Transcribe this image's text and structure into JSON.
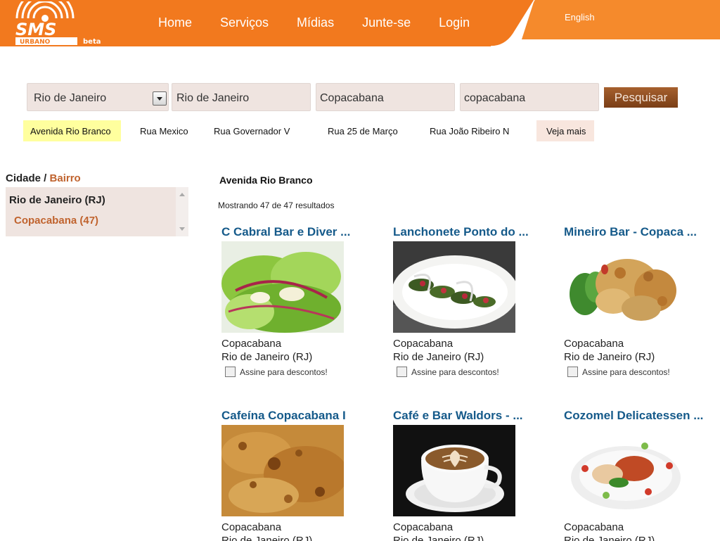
{
  "header": {
    "logo_text": "SMS",
    "logo_sub": "URBANO",
    "logo_beta": "beta",
    "nav": [
      "Home",
      "Serviços",
      "Mídias",
      "Junte-se",
      "Login"
    ],
    "language": "English",
    "colors": {
      "brand_orange": "#f2791e",
      "link_blue": "#155a8a",
      "accent_brown": "#c0632e"
    }
  },
  "search": {
    "state_select": "Rio de Janeiro",
    "city": "Rio de Janeiro",
    "neighborhood": "Copacabana",
    "query": "copacabana",
    "button": "Pesquisar"
  },
  "streets": {
    "items": [
      "Avenida Rio Branco",
      "Rua Mexico",
      "Rua Governador  V",
      "Rua 25 de Março",
      "Rua João Ribeiro  N"
    ],
    "active_index": 0,
    "more": "Veja mais"
  },
  "sidebar": {
    "title_city": "Cidade",
    "title_sep": " / ",
    "title_bairro": "Bairro",
    "city": "Rio de Janeiro (RJ)",
    "bairro": "Copacabana (47)"
  },
  "results": {
    "heading": "Avenida Rio Branco",
    "count_text": "Mostrando 47 de 47 resultados",
    "items": [
      {
        "title": "C Cabral Bar e Diver ...",
        "neighborhood": "Copacabana",
        "city": "Rio de Janeiro (RJ)",
        "subscribe": "Assine para descontos!",
        "image": "salad-photo"
      },
      {
        "title": "Lanchonete Ponto do ...",
        "neighborhood": "Copacabana",
        "city": "Rio de Janeiro (RJ)",
        "subscribe": "Assine para descontos!",
        "image": "appetizer-plate-photo"
      },
      {
        "title": "Mineiro Bar - Copaca ...",
        "neighborhood": "Copacabana",
        "city": "Rio de Janeiro (RJ)",
        "subscribe": "Assine para descontos!",
        "image": "fried-food-photo"
      },
      {
        "title": "Cafeína Copacabana I",
        "neighborhood": "Copacabana",
        "city": "Rio de Janeiro (RJ)",
        "subscribe": "",
        "image": "pastry-crumble-photo"
      },
      {
        "title": "Café e Bar Waldors - ...",
        "neighborhood": "Copacabana",
        "city": "Rio de Janeiro (RJ)",
        "subscribe": "",
        "image": "latte-art-cup-photo"
      },
      {
        "title": "Cozomel Delicatessen ...",
        "neighborhood": "Copacabana",
        "city": "Rio de Janeiro (RJ)",
        "subscribe": "",
        "image": "dish-plate-photo"
      }
    ]
  }
}
